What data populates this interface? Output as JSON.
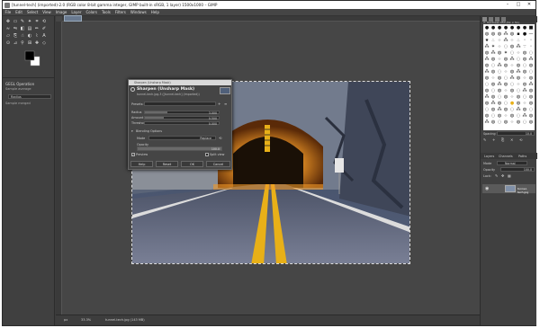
{
  "window": {
    "title": "[tunnel-tech] (imported)-2.0 (RGB color 8-bit gamma integer, GIMP built-in sRGB, 1 layer) 1500x1000 – GIMP",
    "controls": [
      "–",
      "□",
      "✕"
    ]
  },
  "menu": [
    "File",
    "Edit",
    "Select",
    "View",
    "Image",
    "Layer",
    "Colors",
    "Tools",
    "Filters",
    "Windows",
    "Help"
  ],
  "toolbox": {
    "icons": [
      "move-icon",
      "rect-select-icon",
      "free-select-icon",
      "fuzzy-select-icon",
      "crop-icon",
      "transform-icon",
      "warp-icon",
      "flip-icon",
      "fill-icon",
      "gradient-icon",
      "paintbrush-icon",
      "pencil-icon",
      "eraser-icon",
      "clone-icon",
      "smudge-icon",
      "dodge-icon",
      "path-icon",
      "text-icon",
      "color-picker-icon",
      "measure-icon",
      "zoom-icon",
      "align-icon",
      "heal-icon",
      "perspective-icon"
    ],
    "options_title": "GEGL Operation",
    "options_row1": "Sample average",
    "options_field": "Radius",
    "options_row2": "Sample merged"
  },
  "dialog": {
    "title": "Sharpen (Unsharp Mask)",
    "heading": "Sharpen (Unsharp Mask)",
    "sub": "tunnel-tech.jpg-3 ([tunnel-tech] (imported))",
    "presets_label": "Presets:",
    "radius_label": "Radius",
    "radius_value": "3.000",
    "radius_fraction": 0.3,
    "amount_label": "Amount",
    "amount_value": "0.500",
    "amount_fraction": 0.25,
    "threshold_label": "Threshold",
    "threshold_value": "0.000",
    "threshold_fraction": 0,
    "blending_label": "Blending Options",
    "mode_label": "Mode",
    "mode_value": "Replace",
    "opacity_label": "Opacity",
    "opacity_value": "100.0",
    "opacity_fraction": 1,
    "preview_label": "Preview",
    "split_label": "Split view",
    "buttons": [
      "Help",
      "Reset",
      "OK",
      "Cancel"
    ]
  },
  "status": {
    "zoom_unit": "px",
    "zoom": "33.3%",
    "file": "tunnel-tech.jpg (143 MB)"
  },
  "rightdock": {
    "brush_title": "2. Hardness 050 (51 × 51)",
    "spacing_label": "Spacing",
    "spacing_value": "10.0",
    "tabs": [
      "Layers",
      "Channels",
      "Paths"
    ],
    "mode_label": "Mode",
    "mode_value": "Normal",
    "opacity_label": "Opacity",
    "opacity_value": "100.0",
    "lock_label": "Lock:",
    "layer_name": "tunnel-tech.jpg"
  },
  "colors": {
    "fg": "#000000",
    "bg": "#ffffff",
    "tunnel_light": "#f29a28",
    "road_line": "#e8b018"
  }
}
